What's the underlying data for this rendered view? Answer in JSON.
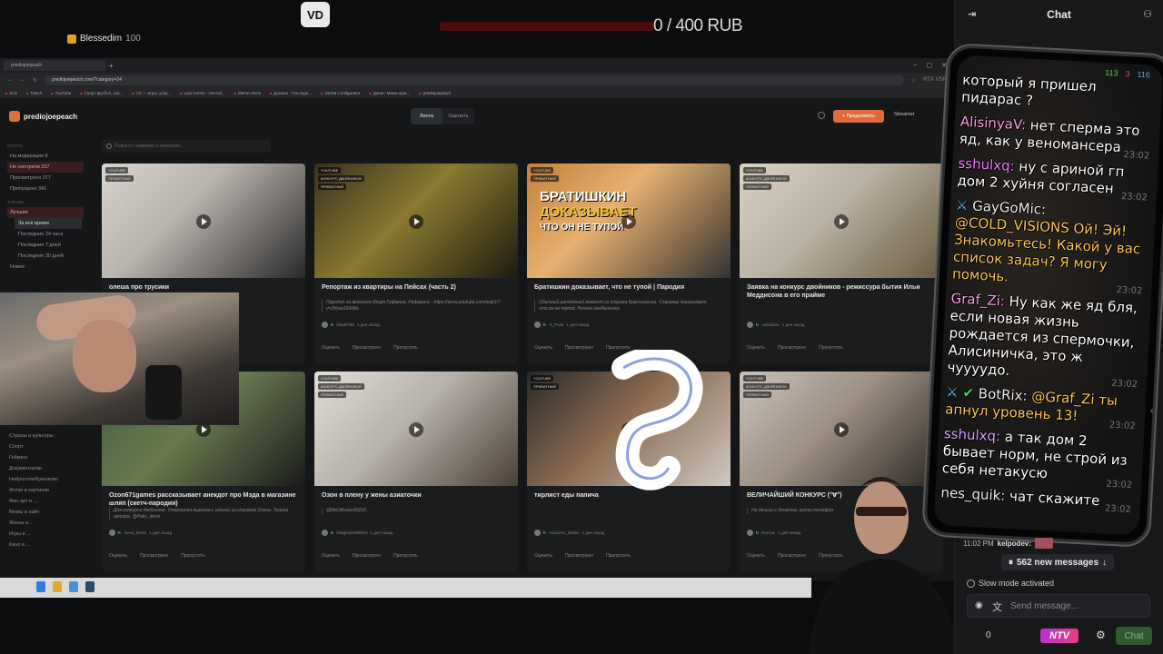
{
  "overlay": {
    "logo_text": "VD",
    "donation_amount": "0 / 400 RUB",
    "donation_progress": 0
  },
  "browser": {
    "tab_title": "prediojoepeach",
    "new_tab": "+",
    "url": "prediojoepeach.com/?category=24",
    "bookmarks": [
      "Kick",
      "Twitch",
      "YouTube",
      "Спорт футбол, хок...",
      "CS — игры, хоко...",
      "Last events - Overall...",
      "Meme Alerts",
      "Донаты - Последн...",
      "NZXM Configurator",
      "Донат: Мини игра...",
      "prediojoepeach"
    ],
    "extension_label": "RTX VSR"
  },
  "app": {
    "brand": "prediojoepeach",
    "switch_feed": "Лента",
    "switch_feed_sub": "420 видео",
    "switch_rate": "Оценить",
    "switch_rate_sub": "60 видео",
    "suggest_button": "+ Предложить",
    "streamer_label": "Streamer",
    "search_placeholder": "Поиск по названию и описанию...",
    "sidebar": {
      "status_heading": "СТАТУС",
      "status_items": [
        "На модерации 8",
        "Не смотрели 337",
        "Просмотрено 377",
        "Пропущено 341"
      ],
      "period_heading": "ЗАКАЗЫ",
      "best_label": "Лучшее",
      "period_items": [
        "За всё время",
        "Последние 24 часа",
        "Последние 7 дней",
        "Последние 30 дней"
      ],
      "new_label": "Новое",
      "categories": [
        "Страны и культуры",
        "Спорт",
        "Гейминг",
        "Документалки",
        "Нейросети/Кринжово",
        "Фотки и картинки",
        "Фан-арт и ...",
        "Мемы и хайп",
        "Жизнь и...",
        "Игры и ...",
        "Кино и ..."
      ]
    },
    "cards": [
      {
        "tags": [
          "YOUTUBE",
          "ПРИВАТНЫЙ"
        ],
        "title": "олеша про трусики",
        "desc": "",
        "author": "",
        "time": "",
        "actions": [
          "Оценить",
          "Просмотрено",
          "Пропустить"
        ]
      },
      {
        "tags": [
          "YOUTUBE",
          "КОНКУРС ДВОЙНИКОВ",
          "ПРИВАТНЫЙ"
        ],
        "title": "Репортаж из квартиры на Пейсах (часть 2)",
        "desc": "Пародия на великого Игоря Гофмана. Референс - https://www.youtube.com/watch?v=JHyas1EK8io",
        "author": "shade786",
        "time": "1 дня назад",
        "actions": [
          "Оценить",
          "Просмотрено",
          "Пропустить"
        ]
      },
      {
        "tags": [
          "YOUTUBE",
          "ПРИВАТНЫЙ"
        ],
        "title": "Братишкин доказывает, что не тупой | Пародия",
        "desc": "Обычный рандомный момент со стрима Братишкина. Стример доказывает, что он не тупой. Ничего необычного.",
        "author": "G_Punk",
        "time": "1 дня назад",
        "actions": [
          "Оценить",
          "Просмотрено",
          "Пропустить"
        ],
        "thumb_text": [
          "БРАТИШКИН",
          "ДОКАЗЫВАЕТ",
          "ЧТО ОН НЕ ТУПОЙ"
        ]
      },
      {
        "tags": [
          "YOUTUBE",
          "КОНКУРС ДВОЙНИКОВ",
          "ПРИВАТНЫЙ"
        ],
        "title": "Заявка на конкурс двойников - режиссура бытия Ильи Меддисона в его прайме",
        "desc": "",
        "author": "valeasaru",
        "time": "1 дня назад",
        "actions": [
          "Оценить",
          "Просмотрено",
          "Пропустить"
        ]
      },
      {
        "tags": [
          "YOUTUBE",
          "ПРИВАТНЫЙ"
        ],
        "title": "Ozon671games рассказывает анекдот про Мэда в магазине шляп (скетч-пародия)",
        "desc": "Для конкурса двойников. Утерянная вырезка с одного из стримов Озона. Телега автора: @Paks_devis",
        "author": "Alexa_Devis",
        "time": "1 дня назад",
        "actions": [
          "Оценить",
          "Просмотрено",
          "Пропустить"
        ]
      },
      {
        "tags": [
          "YOUTUBE",
          "КОНКУРС ДВОЙНИКОВ",
          "ПРИВАТНЫЙ"
        ],
        "title": "Озон в плену у жены азиаточки",
        "desc": "@MeOBsoon90210",
        "author": "meighsson90210",
        "time": "1 дня назад",
        "actions": [
          "Оценить",
          "Просмотрено",
          "Пропустить"
        ]
      },
      {
        "tags": [
          "YOUTUBE",
          "ПРИВАТНЫЙ"
        ],
        "title": "тирлист еды папича",
        "desc": "",
        "author": "marsiens_twises",
        "time": "1 дня назад",
        "actions": [
          "Оценить",
          "Просмотрено",
          "Пропустить"
        ]
      },
      {
        "tags": [
          "YOUTUBE",
          "КОНКУРС ДВОЙНИКОВ",
          "ПРИВАТНЫЙ"
        ],
        "title": "ВЕЛИЧАЙШИЙ КОНКУРС (°∀°)",
        "desc": "На деньги с донатов, куплю телефон",
        "author": "Evecan",
        "time": "1 дня назад",
        "actions": [
          "Оценить",
          "Просмотрено",
          "Пропустить"
        ]
      }
    ]
  },
  "chat": {
    "title": "Chat",
    "pinned_user": "Blessedim",
    "pinned_amount": "100",
    "phone_status": {
      "kick": "113",
      "red": "3",
      "viewers": "116"
    },
    "messages": [
      {
        "nick": "",
        "text": "который я пришел пидарас ?",
        "time": ""
      },
      {
        "nick": "AlisinyaV:",
        "text": "нет сперма это яд, как у веномансера",
        "time": "23:02"
      },
      {
        "nick": "sshulxq:",
        "text": "ну с ариной гп дом 2 хуйня согласен",
        "time": "23:02"
      },
      {
        "nick": "GayGoMic:",
        "text": "@COLD_VISIONS Ой! Эй! Знакомьтесь! Какой у вас список задач? Я могу помочь.",
        "mention": "@COLD_VISIONS",
        "time": "23:02"
      },
      {
        "nick": "Graf_Zi:",
        "text": "Ну как же яд бля, если новая жизнь рождается из спермочки, Алисиничка, это ж чуууудо.",
        "time": "23:02"
      },
      {
        "nick": "BotRix:",
        "text": "@Graf_Zi ты апнул уровень 13!",
        "mention": "@Graf_Zi",
        "time": "23:02"
      },
      {
        "nick": "sshulxq:",
        "text": "а так дом 2 бывает норм, не строй из себя нетакусю",
        "time": "23:02"
      },
      {
        "nick": "nes_quik:",
        "text": "чат скажите",
        "time": "23:02"
      }
    ],
    "bottom_time": "11:02 PM",
    "bottom_nick": "kelpodev:",
    "new_messages": "562 new messages",
    "slow_mode": "Slow mode activated",
    "send_placeholder": "Send message...",
    "counter": "0",
    "ntv_label": "NTV",
    "chat_button": "Chat"
  },
  "colors": {
    "accent": "#e06b3a",
    "kick_green": "#53fc18",
    "donation_red": "#c0262a"
  }
}
